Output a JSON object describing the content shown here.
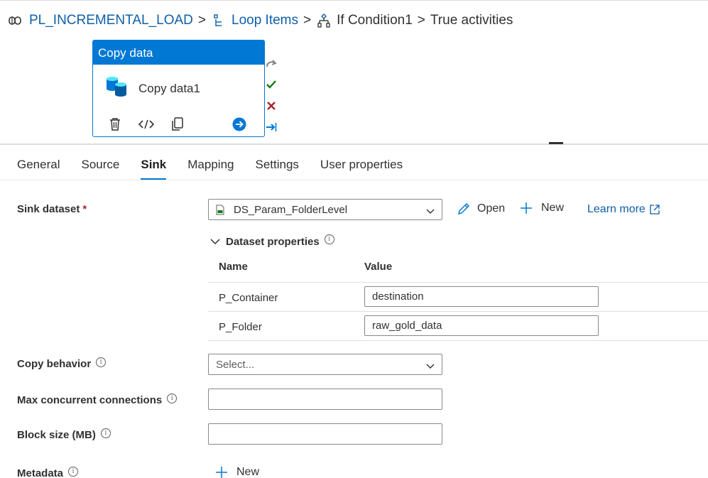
{
  "breadcrumb": {
    "pipeline": "PL_INCREMENTAL_LOAD",
    "foreach": "Loop Items",
    "ifcond": "If Condition1",
    "current": "True activities",
    "separator": ">"
  },
  "activity_card": {
    "type_label": "Copy data",
    "name": "Copy data1",
    "icons": [
      "delete-icon",
      "code-icon",
      "copy-icon",
      "go-arrow-icon"
    ],
    "status_icons": [
      "skipped-icon",
      "success-icon",
      "failure-icon",
      "completion-icon"
    ],
    "colors": {
      "header": "#0078d4",
      "success": "#107c10",
      "failure": "#a4262c"
    }
  },
  "tabs": [
    "General",
    "Source",
    "Sink",
    "Mapping",
    "Settings",
    "User properties"
  ],
  "active_tab": "Sink",
  "sink": {
    "dataset_label": "Sink dataset",
    "required_mark": "*",
    "dataset_value": "DS_Param_FolderLevel",
    "open_label": "Open",
    "new_label": "New",
    "learn_more_label": "Learn more",
    "dataset_properties_label": "Dataset properties",
    "col_name": "Name",
    "col_value": "Value",
    "properties": [
      {
        "name": "P_Container",
        "value": "destination"
      },
      {
        "name": "P_Folder",
        "value": "raw_gold_data"
      }
    ],
    "copy_behavior_label": "Copy behavior",
    "copy_behavior_placeholder": "Select...",
    "max_conn_label": "Max concurrent connections",
    "max_conn_value": "",
    "block_size_label": "Block size (MB)",
    "block_size_value": "",
    "metadata_label": "Metadata",
    "metadata_new_label": "New"
  }
}
